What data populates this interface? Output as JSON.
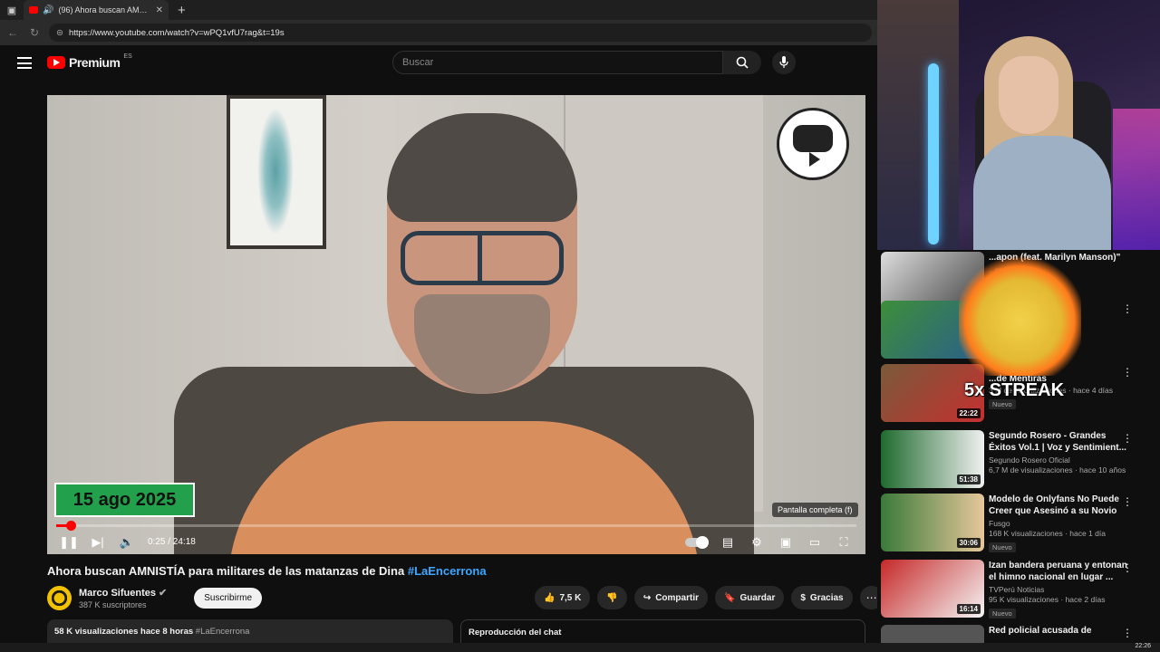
{
  "browser": {
    "tab_title": "(96) Ahora buscan AMNISTÍA",
    "url": "https://www.youtube.com/watch?v=wPQ1vfU7rag&t=19s"
  },
  "youtube": {
    "brand": "Premium",
    "country": "ES",
    "search_placeholder": "Buscar"
  },
  "player": {
    "date_overlay": "15 ago 2025",
    "time_current": "0:25",
    "time_total": "24:18",
    "time_display": "0:25 / 24:18",
    "progress_fraction": 0.017,
    "tooltip": "Pantalla completa (f)"
  },
  "video": {
    "title": "Ahora buscan AMNISTÍA para militares de las matanzas de Dina",
    "hashtag": "#LaEncerrona",
    "channel": "Marco Sifuentes",
    "subscribers": "387 K suscriptores",
    "subscribe_label": "Suscribirme",
    "likes": "7,5 K",
    "share_label": "Compartir",
    "save_label": "Guardar",
    "thanks_label": "Gracias",
    "views_time": "58 K visualizaciones  hace 8 horas",
    "desc_tag": "#LaEncerrona",
    "chat_label": "Reproducción del chat"
  },
  "overlay": {
    "streak_text": "5x STREAK"
  },
  "related": [
    {
      "title": "...apon (feat. Marilyn Manson)\"",
      "channel": "...ords",
      "meta": "...ace 2 meses",
      "duration": "",
      "badge": ""
    },
    {
      "title": "...O en ...Te ...",
      "channel": "",
      "meta": "...8 días",
      "duration": "",
      "badge": ""
    },
    {
      "title": "...de Mentiras",
      "channel": "",
      "meta": "3 M de visualizaciones · hace 4 días",
      "duration": "22:22",
      "badge": "Nuevo"
    },
    {
      "title": "Segundo Rosero - Grandes Éxitos Vol.1 | Voz y Sentimient...",
      "channel": "Segundo Rosero Oficial",
      "meta": "6,7 M de visualizaciones · hace 10 años",
      "duration": "51:38",
      "badge": ""
    },
    {
      "title": "Modelo de Onlyfans No Puede Creer que Asesinó a su Novio",
      "channel": "Fusgo",
      "meta": "168 K visualizaciones · hace 1 día",
      "duration": "30:06",
      "badge": "Nuevo"
    },
    {
      "title": "Izan bandera peruana y entonan el himno nacional en lugar ...",
      "channel": "TVPerú Noticias",
      "meta": "95 K visualizaciones · hace 2 días",
      "duration": "16:14",
      "badge": "Nuevo"
    },
    {
      "title": "Red policial acusada de",
      "channel": "",
      "meta": "",
      "duration": "",
      "badge": ""
    }
  ],
  "taskbar": {
    "clock": "22:26"
  },
  "colors": {
    "accent": "#ff0000",
    "link": "#3ea6ff",
    "date_overlay_bg": "#22a04c"
  }
}
